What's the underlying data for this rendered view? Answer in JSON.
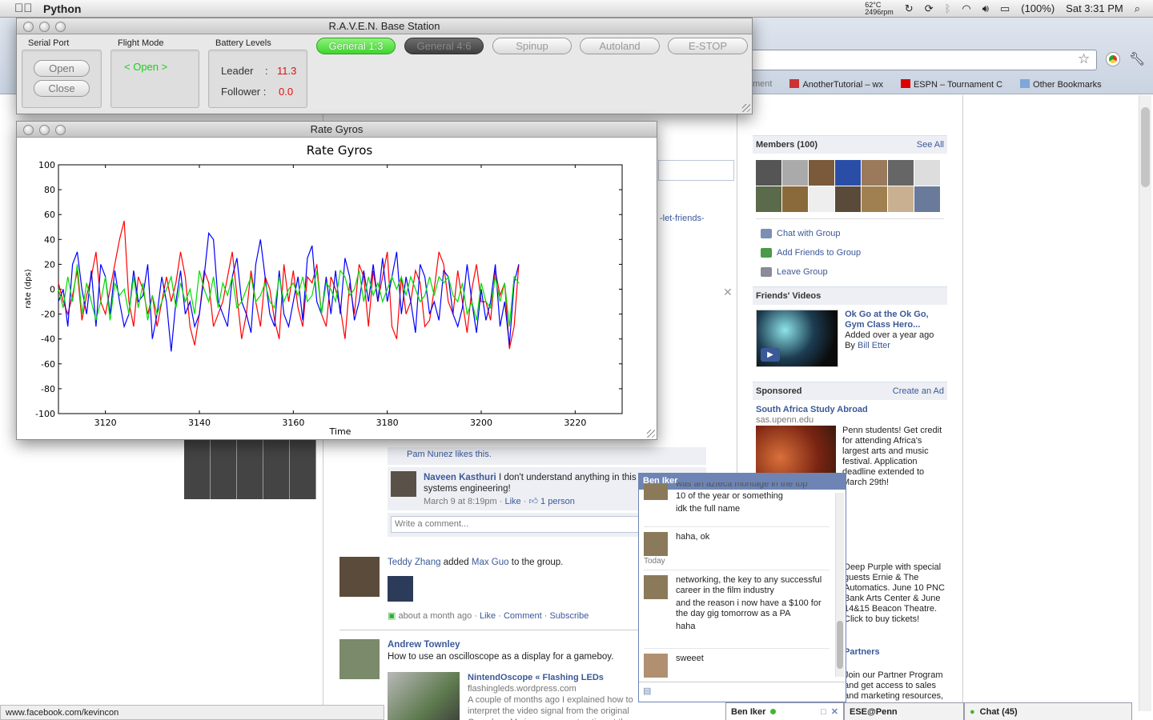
{
  "menubar": {
    "app_name": "Python",
    "temperature": "62°C",
    "rpm": "2496rpm",
    "battery": "(100%)",
    "clock": "Sat 3:31 PM"
  },
  "browser": {
    "bookmarks": [
      {
        "label": "ment"
      },
      {
        "label": "AnotherTutorial – wx"
      },
      {
        "label": "ESPN – Tournament C"
      },
      {
        "label": "Other Bookmarks"
      }
    ],
    "status_url": "www.facebook.com/kevincon"
  },
  "facebook": {
    "members_header": "Members (100)",
    "see_all": "See All",
    "actions": [
      "Chat with Group",
      "Add Friends to Group",
      "Leave Group"
    ],
    "friends_videos_header": "Friends' Videos",
    "video": {
      "title": "Ok Go at the Ok Go, Gym Class Hero...",
      "added": "Added over a year ago",
      "by_prefix": "By",
      "by_name": "Bill Etter"
    },
    "sponsored_header": "Sponsored",
    "create_ad": "Create an Ad",
    "ad1": {
      "title": "South Africa Study Abroad",
      "domain": "sas.upenn.edu",
      "body": "Penn students! Get credit for attending Africa's largest arts and music festival. Application deadline extended to March 29th!"
    },
    "ad2_body": "Deep Purple with special guests Ernie & The Automatics. June 10 PNC Bank Arts Center & June 14&15 Beacon Theatre. Click to buy tickets!",
    "ad3_title": "Partners",
    "ad3_body": "Join our Partner Program and get access to sales and marketing resources, a personal account",
    "link_fragment": "-let-friends-",
    "likes_text": "Pam Nunez likes this.",
    "comment": {
      "author": "Naveen Kasthuri",
      "text": "I don't understand anything in this comic. Yay systems engineering!",
      "meta": "March 9 at 8:19pm",
      "like": "Like",
      "likes_count": "1 person"
    },
    "write_comment_placeholder": "Write a comment...",
    "post2": {
      "author": "Teddy Zhang",
      "verb": "added",
      "target": "Max Guo",
      "suffix": "to the group.",
      "time": "about a month ago",
      "like": "Like",
      "comment": "Comment",
      "subscribe": "Subscribe"
    },
    "post3": {
      "author": "Andrew Townley",
      "text": "How to use an oscilloscope as a display for a gameboy.",
      "link_title": "NintendOscope « Flashing LEDs",
      "link_domain": "flashingleds.wordpress.com",
      "link_body": "A couple of months ago I explained how to interpret the video signal from the original Gameboy. My image reconstruction at the time was done in a graphing program with some saved data. Good for a"
    },
    "chat": {
      "title": "Ben Iker",
      "msg0_cut": "was an azteca montage in the top",
      "msg0a": "10 of the year or something",
      "msg0b": "idk the full name",
      "msg1": "haha, ok",
      "day": "Today",
      "msg2a": "networking, the key to any successful career in the film industry",
      "msg2b": "and the reason i now have a $100 for the day gig tomorrow as a PA",
      "msg2c": "haha",
      "msg3": "sweeet"
    },
    "dock": {
      "tab1": "Ben Iker",
      "tab2": "ESE@Penn",
      "tab3": "Chat (45)"
    }
  },
  "raven": {
    "title": "R.A.V.E.N. Base Station",
    "serial_port_label": "Serial Port",
    "open_button": "Open",
    "close_button": "Close",
    "flight_mode_label": "Flight Mode",
    "flight_mode_value": "< Open >",
    "battery_label": "Battery Levels",
    "leader_label": "Leader",
    "leader_colon": ":",
    "leader_value": "11.3",
    "follower_label": "Follower :",
    "follower_value": "0.0",
    "buttons": [
      "General 1:3",
      "General 4:6",
      "Spinup",
      "Autoland",
      "E-STOP"
    ],
    "colors": {
      "active_green": "#3fd52d",
      "battery_red": "#e01010",
      "flight_mode_green": "#1fcc1f"
    }
  },
  "gyro_window": {
    "title": "Rate Gyros"
  },
  "chart_data": {
    "type": "line",
    "title": "Rate Gyros",
    "xlabel": "Time",
    "ylabel": "rate (dps)",
    "xlim": [
      3110,
      3230
    ],
    "ylim": [
      -100,
      100
    ],
    "xticks": [
      3120,
      3140,
      3160,
      3180,
      3200,
      3220
    ],
    "yticks": [
      100,
      80,
      60,
      40,
      20,
      0,
      -20,
      -40,
      -60,
      -80,
      -100
    ],
    "x": [
      3110,
      3111,
      3112,
      3113,
      3114,
      3115,
      3116,
      3117,
      3118,
      3119,
      3120,
      3121,
      3122,
      3123,
      3124,
      3125,
      3126,
      3127,
      3128,
      3129,
      3130,
      3131,
      3132,
      3133,
      3134,
      3135,
      3136,
      3137,
      3138,
      3139,
      3140,
      3141,
      3142,
      3143,
      3144,
      3145,
      3146,
      3147,
      3148,
      3149,
      3150,
      3151,
      3152,
      3153,
      3154,
      3155,
      3156,
      3157,
      3158,
      3159,
      3160,
      3161,
      3162,
      3163,
      3164,
      3165,
      3166,
      3167,
      3168,
      3169,
      3170,
      3171,
      3172,
      3173,
      3174,
      3175,
      3176,
      3177,
      3178,
      3179,
      3180,
      3181,
      3182,
      3183,
      3184,
      3185,
      3186,
      3187,
      3188,
      3189,
      3190,
      3191,
      3192,
      3193,
      3194,
      3195,
      3196,
      3197,
      3198,
      3199,
      3200,
      3201,
      3202,
      3203,
      3204,
      3205,
      3206,
      3207,
      3208
    ],
    "series": [
      {
        "color": "#ff0000",
        "values": [
          5,
          -10,
          -20,
          -5,
          15,
          -25,
          -5,
          10,
          30,
          -10,
          -20,
          0,
          20,
          40,
          55,
          -10,
          -30,
          10,
          0,
          -20,
          -5,
          -30,
          -10,
          10,
          -10,
          5,
          30,
          10,
          -30,
          -45,
          -20,
          15,
          5,
          -30,
          -20,
          -10,
          10,
          30,
          -5,
          -40,
          -20,
          15,
          -10,
          -30,
          10,
          0,
          -25,
          -40,
          20,
          -10,
          15,
          -15,
          -30,
          10,
          5,
          20,
          -20,
          -30,
          10,
          0,
          -15,
          -40,
          5,
          -20,
          20,
          10,
          -30,
          15,
          -10,
          10,
          30,
          -30,
          -40,
          10,
          -20,
          -10,
          15,
          5,
          -30,
          -25,
          0,
          30,
          20,
          -10,
          -20,
          15,
          -10,
          -35,
          0,
          20,
          -10,
          -10,
          -25,
          15,
          -5,
          5,
          -48,
          -30,
          20
        ]
      },
      {
        "color": "#0000ff",
        "values": [
          -10,
          0,
          -30,
          20,
          30,
          0,
          -20,
          15,
          -30,
          20,
          10,
          -20,
          15,
          -10,
          -30,
          -20,
          15,
          -10,
          -5,
          20,
          -40,
          -20,
          10,
          -10,
          -50,
          -10,
          15,
          -20,
          -10,
          -30,
          -20,
          10,
          45,
          40,
          -10,
          -20,
          -30,
          10,
          25,
          -10,
          -20,
          -35,
          20,
          40,
          10,
          -20,
          -30,
          15,
          -20,
          -30,
          -10,
          10,
          -25,
          25,
          35,
          -10,
          -20,
          10,
          -20,
          15,
          -20,
          25,
          10,
          -25,
          -10,
          15,
          -10,
          20,
          -10,
          25,
          -10,
          10,
          30,
          -20,
          10,
          -10,
          -35,
          20,
          10,
          -20,
          -10,
          -25,
          15,
          10,
          -20,
          -30,
          -15,
          20,
          -10,
          -35,
          0,
          -25,
          -10,
          20,
          -30,
          -10,
          -45,
          5,
          20
        ]
      },
      {
        "color": "#00dd00",
        "values": [
          0,
          -15,
          10,
          -10,
          20,
          -20,
          5,
          -10,
          -25,
          -10,
          10,
          -25,
          5,
          -5,
          0,
          -20,
          10,
          -15,
          5,
          -25,
          -5,
          -20,
          -10,
          0,
          10,
          -15,
          5,
          -10,
          0,
          -20,
          15,
          0,
          -10,
          10,
          -15,
          5,
          -5,
          10,
          -15,
          -10,
          0,
          10,
          -10,
          -5,
          5,
          -10,
          -15,
          10,
          -10,
          0,
          5,
          -5,
          10,
          -10,
          -5,
          15,
          -20,
          5,
          0,
          -10,
          15,
          10,
          -5,
          0,
          15,
          -10,
          10,
          -5,
          5,
          -10,
          0,
          10,
          0,
          10,
          -5,
          10,
          0,
          -10,
          -5,
          10,
          -5,
          10,
          5,
          10,
          -5,
          -10,
          5,
          -20,
          -10,
          -25,
          5,
          -10,
          -15,
          10,
          -10,
          5,
          -30,
          10,
          5
        ]
      }
    ]
  }
}
